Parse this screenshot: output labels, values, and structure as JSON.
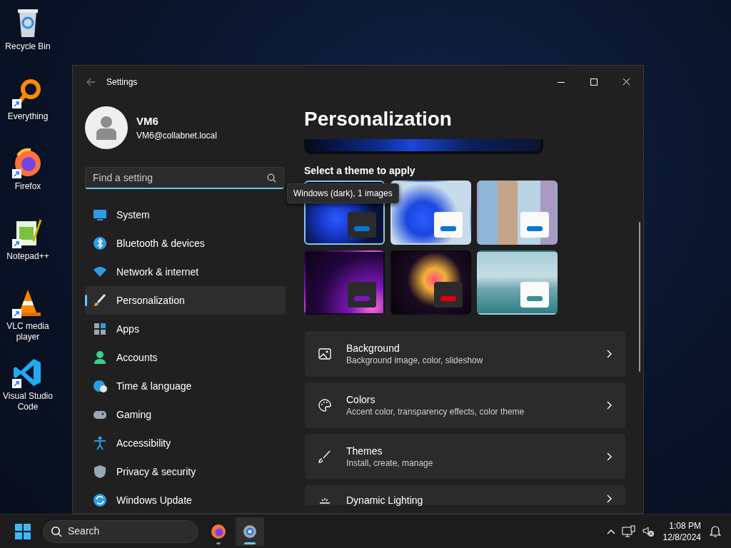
{
  "desktop_icons": [
    {
      "label": "Recycle Bin",
      "shortcut": false
    },
    {
      "label": "Everything",
      "shortcut": true
    },
    {
      "label": "Firefox",
      "shortcut": true
    },
    {
      "label": "Notepad++",
      "shortcut": true
    },
    {
      "label": "VLC media player",
      "shortcut": true
    },
    {
      "label": "Visual Studio Code",
      "shortcut": true
    }
  ],
  "window": {
    "title": "Settings"
  },
  "user": {
    "name": "VM6",
    "email": "VM6@collabnet.local"
  },
  "search": {
    "placeholder": "Find a setting"
  },
  "sidebar": {
    "items": [
      {
        "label": "System",
        "selected": false
      },
      {
        "label": "Bluetooth & devices",
        "selected": false
      },
      {
        "label": "Network & internet",
        "selected": false
      },
      {
        "label": "Personalization",
        "selected": true
      },
      {
        "label": "Apps",
        "selected": false
      },
      {
        "label": "Accounts",
        "selected": false
      },
      {
        "label": "Time & language",
        "selected": false
      },
      {
        "label": "Gaming",
        "selected": false
      },
      {
        "label": "Accessibility",
        "selected": false
      },
      {
        "label": "Privacy & security",
        "selected": false
      },
      {
        "label": "Windows Update",
        "selected": false
      }
    ]
  },
  "page": {
    "title": "Personalization",
    "themes_label": "Select a theme to apply",
    "tooltip": "Windows (dark), 1 images",
    "themes": [
      {
        "kind": "dark",
        "color": "#0078d4",
        "selected": true
      },
      {
        "kind": "light",
        "color": "#0078d4",
        "selected": false
      },
      {
        "kind": "light",
        "color": "#0078d4",
        "selected": false
      },
      {
        "kind": "dark",
        "color": "#7a16c2",
        "selected": false
      },
      {
        "kind": "dark",
        "color": "#e0000f",
        "selected": false
      },
      {
        "kind": "light",
        "color": "#3a8f96",
        "selected": false
      }
    ],
    "cards": [
      {
        "title": "Background",
        "subtitle": "Background image, color, slideshow"
      },
      {
        "title": "Colors",
        "subtitle": "Accent color, transparency effects, color theme"
      },
      {
        "title": "Themes",
        "subtitle": "Install, create, manage"
      },
      {
        "title": "Dynamic Lighting"
      }
    ]
  },
  "taskbar": {
    "search_placeholder": "Search",
    "apps": [
      {
        "selected": false,
        "running": true
      },
      {
        "selected": true,
        "running": true
      }
    ],
    "time": "1:08 PM",
    "date": "12/8/2024"
  }
}
